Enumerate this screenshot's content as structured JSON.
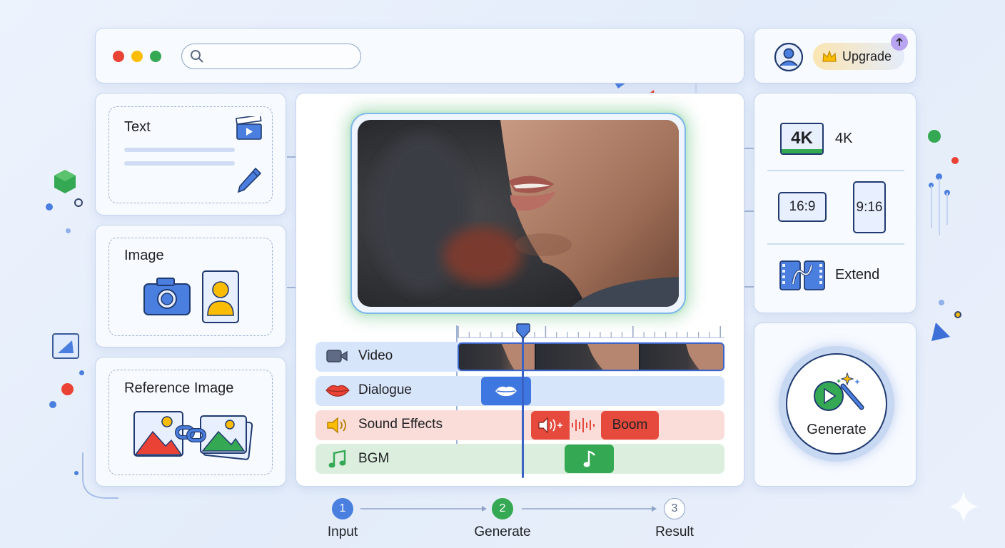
{
  "panels": {
    "text": {
      "title": "Text"
    },
    "image": {
      "title": "Image"
    },
    "reference": {
      "title": "Reference Image"
    }
  },
  "header": {
    "window_dots": [
      "#ea4335",
      "#fbbc04",
      "#34a853"
    ],
    "search_placeholder": "",
    "upgrade_label": "Upgrade"
  },
  "settings": {
    "resolution_badge": "4K",
    "resolution_label": "4K",
    "aspect_landscape": "16:9",
    "aspect_portrait": "9:16",
    "extend_label": "Extend"
  },
  "generate": {
    "label": "Generate"
  },
  "timeline": {
    "tracks": [
      {
        "label": "Video",
        "icon": "video-camera-icon"
      },
      {
        "label": "Dialogue",
        "icon": "lips-icon"
      },
      {
        "label": "Sound Effects",
        "icon": "speaker-icon"
      },
      {
        "label": "BGM",
        "icon": "music-note-icon"
      }
    ],
    "sfx_chip_label": "Boom"
  },
  "steps": [
    {
      "number": "1",
      "label": "Input"
    },
    {
      "number": "2",
      "label": "Generate"
    },
    {
      "number": "3",
      "label": "Result"
    }
  ],
  "colors": {
    "accent_blue": "#4a7fe0",
    "accent_green": "#34a853",
    "accent_red": "#ea4335",
    "accent_yellow": "#fbbc04"
  }
}
